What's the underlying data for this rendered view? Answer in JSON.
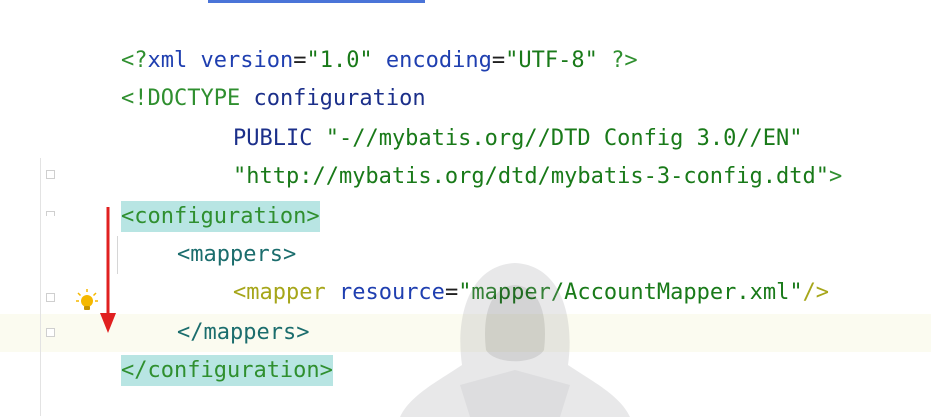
{
  "editor": {
    "lines": {
      "l1": {
        "lt": "<?",
        "name": "xml",
        "a1": " version",
        "eq1": "=",
        "v1": "\"1.0\"",
        "a2": " encoding",
        "eq2": "=",
        "v2": "\"UTF-8\"",
        "end": " ?>"
      },
      "l2": {
        "lt": "<!DOCTYPE",
        "name": " configuration"
      },
      "l3": {
        "kw": "PUBLIC",
        "val": " \"-//mybatis.org//DTD Config 3.0//EN\""
      },
      "l4": {
        "val": "\"http://mybatis.org/dtd/mybatis-3-config.dtd\"",
        "gt": ">"
      },
      "l5": {
        "lt": "<",
        "name": "configuration",
        "gt": ">"
      },
      "l6": {
        "lt": "<",
        "name": "mappers",
        "gt": ">"
      },
      "l7": {
        "lt": "<",
        "name": "mapper",
        "attr": " resource",
        "eq": "=",
        "val": "\"mapper/AccountMapper.xml\"",
        "end": "/>"
      },
      "l8": {
        "lt": "</",
        "name": "mappers",
        "gt": ">"
      },
      "l9": {
        "lt": "</",
        "name": "configuration",
        "gt": ">"
      }
    },
    "icons": {
      "bulb": "lightbulb-icon",
      "arrow": "red-down-arrow-annotation",
      "watermark": "hooded-figure-watermark"
    },
    "colors": {
      "tag_highlight": "#b8e5e3",
      "current_line": "#fbfbf0",
      "tag_name": "#2f8f2f",
      "attribute": "#1f3fb0",
      "string": "#197a19",
      "arrow": "#e02020",
      "bulb": "#f5b800"
    }
  }
}
